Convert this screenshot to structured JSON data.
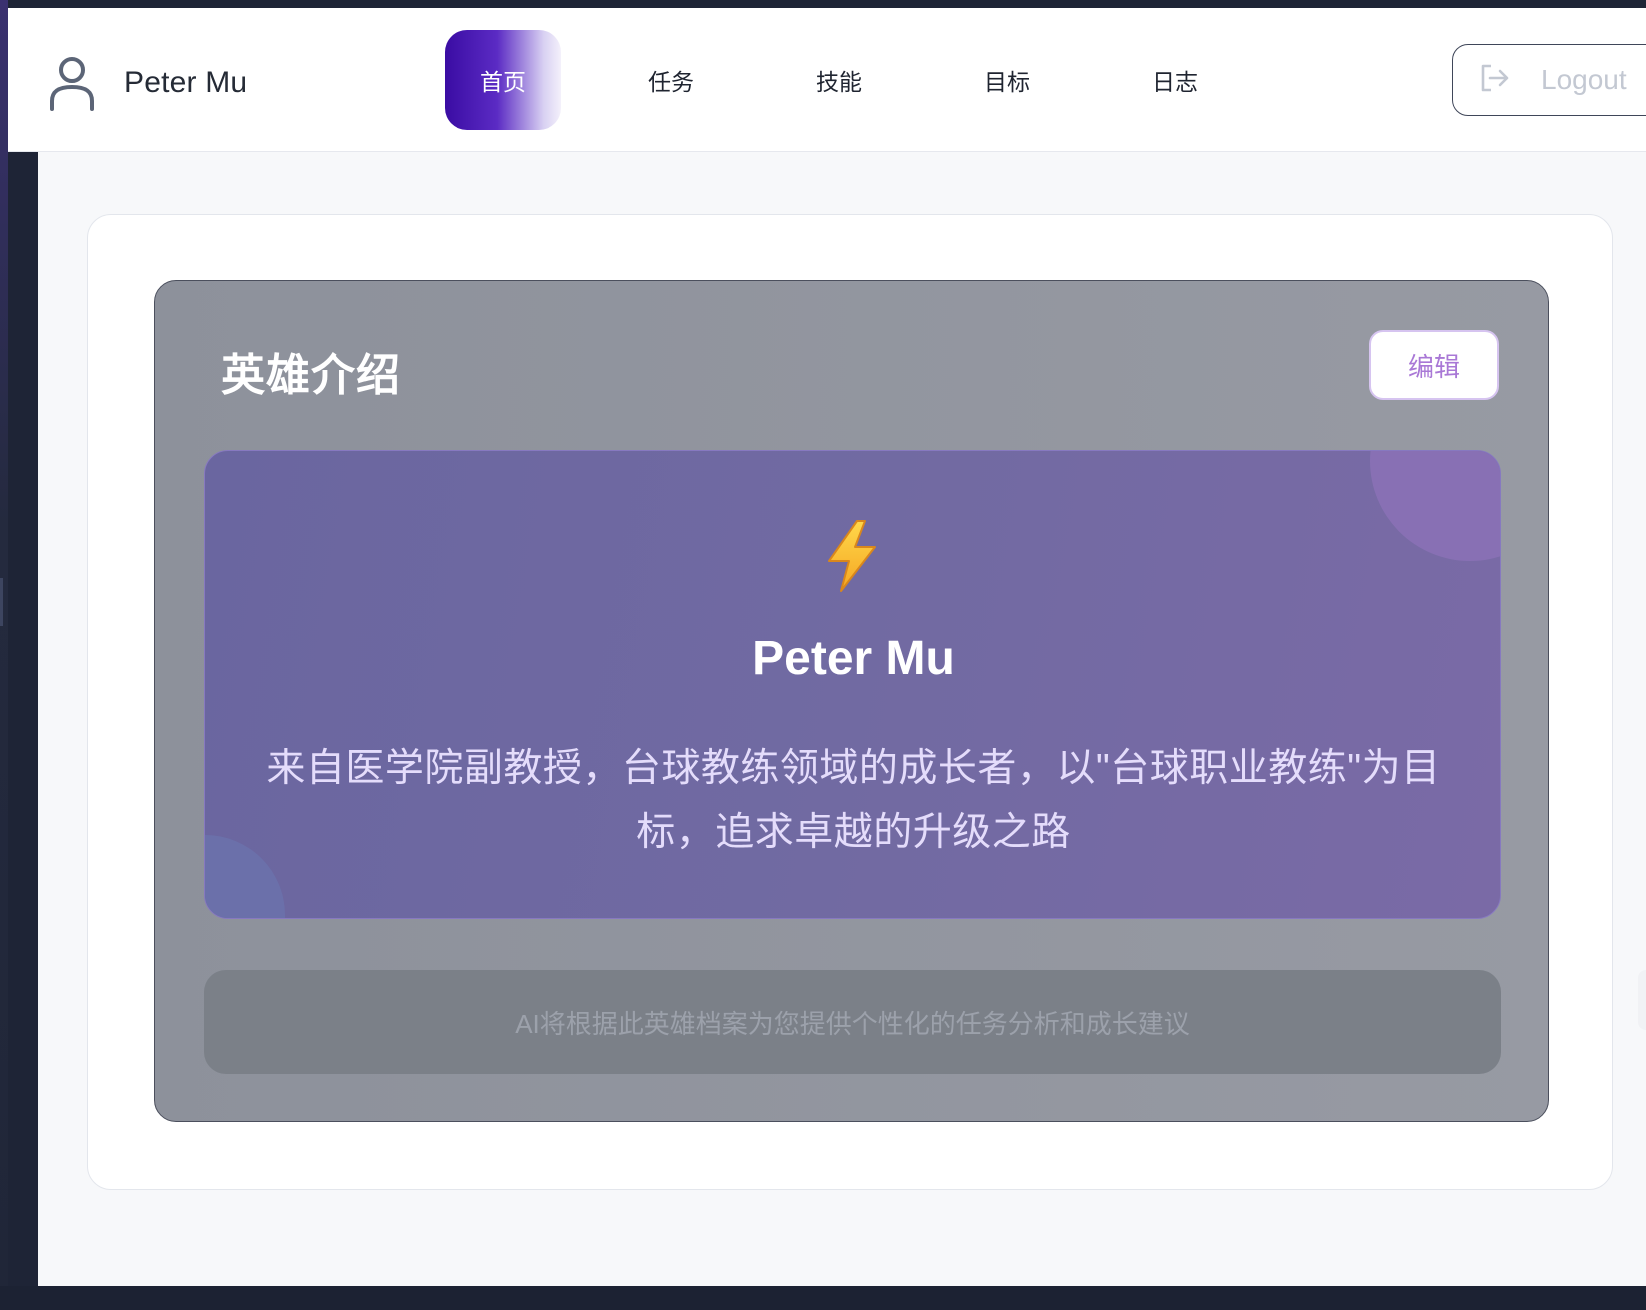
{
  "header": {
    "user_name": "Peter Mu",
    "nav": [
      {
        "label": "首页",
        "active": true
      },
      {
        "label": "任务",
        "active": false
      },
      {
        "label": "技能",
        "active": false
      },
      {
        "label": "目标",
        "active": false
      },
      {
        "label": "日志",
        "active": false
      }
    ],
    "logout_label": "Logout"
  },
  "hero": {
    "title": "英雄介绍",
    "edit_label": "编辑",
    "icon": "lightning-bolt-icon",
    "name": "Peter Mu",
    "description": "来自医学院副教授，台球教练领域的成长者，以\"台球职业教练\"为目标，追求卓越的升级之路",
    "ai_note": "AI将根据此英雄档案为您提供个性化的任务分析和成长建议"
  },
  "colors": {
    "nav_active_start": "#3a0ca3",
    "edit_text": "#a978d6",
    "intro_card": "#716aa2",
    "panel": "#979aa3"
  }
}
